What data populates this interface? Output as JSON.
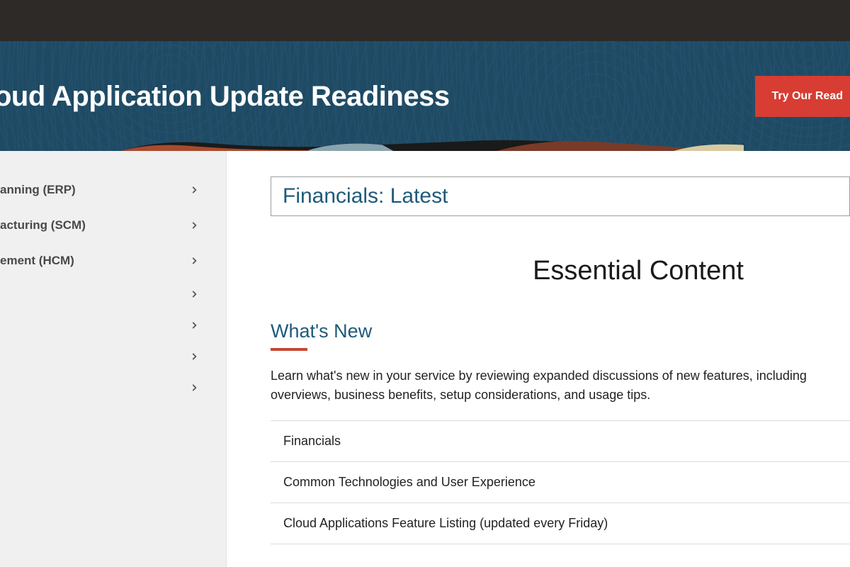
{
  "hero": {
    "title": "oud Application Update Readiness",
    "cta_label": "Try Our Read"
  },
  "sidebar": {
    "items": [
      {
        "label": "anning (ERP)"
      },
      {
        "label": "acturing (SCM)"
      },
      {
        "label": "ement (HCM)"
      },
      {
        "label": ""
      },
      {
        "label": ""
      },
      {
        "label": ""
      },
      {
        "label": ""
      }
    ]
  },
  "main": {
    "dropdown_selected": "Financials: Latest",
    "section_title": "Essential Content",
    "whats_new": {
      "heading": "What's New",
      "description": "Learn what's new in your service by reviewing expanded discussions of new features, including overviews, business benefits, setup considerations, and usage tips.",
      "links": [
        "Financials",
        "Common Technologies and User Experience",
        "Cloud Applications Feature Listing (updated every Friday)"
      ]
    }
  }
}
